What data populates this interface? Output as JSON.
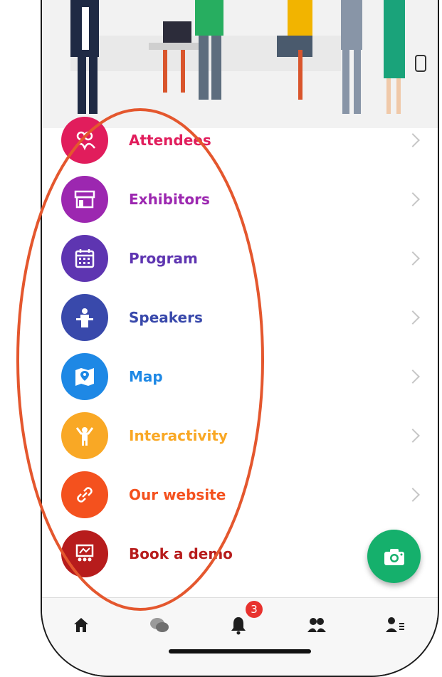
{
  "menu": {
    "items": [
      {
        "label": "Attendees",
        "icon": "attendees-icon",
        "color": "#e11d5c"
      },
      {
        "label": "Exhibitors",
        "icon": "storefront-icon",
        "color": "#9c27b0"
      },
      {
        "label": "Program",
        "icon": "calendar-icon",
        "color": "#5e35b1"
      },
      {
        "label": "Speakers",
        "icon": "podium-icon",
        "color": "#3949ab"
      },
      {
        "label": "Map",
        "icon": "map-pin-icon",
        "color": "#1e88e5"
      },
      {
        "label": "Interactivity",
        "icon": "hand-raise-icon",
        "color": "#f9a825"
      },
      {
        "label": "Our website",
        "icon": "link-icon",
        "color": "#f4511e"
      },
      {
        "label": "Book a demo",
        "icon": "presentation-icon",
        "color": "#b71c1c"
      }
    ]
  },
  "tabbar": {
    "tabs": [
      "home-icon",
      "chat-icon",
      "bell-icon",
      "people-icon",
      "profile-list-icon"
    ],
    "notification_count": "3",
    "active_color": "#1e1e1e"
  },
  "fab": {
    "icon": "camera-icon",
    "color": "#15b06c"
  },
  "annotation": {
    "color": "#e4572e"
  }
}
